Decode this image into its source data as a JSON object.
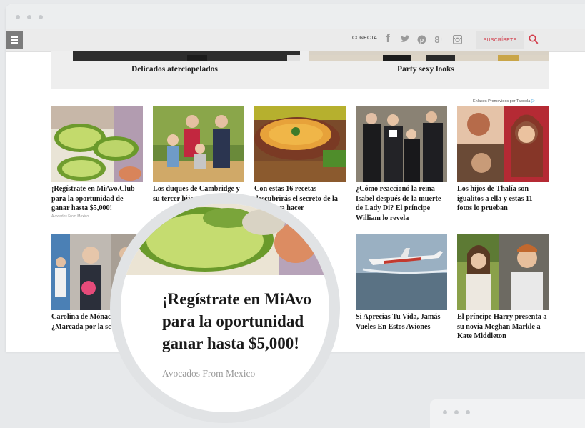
{
  "header": {
    "conecta_label": "CONECTA",
    "social_icons": [
      "facebook-icon",
      "twitter-icon",
      "pinterest-icon",
      "google-plus-icon",
      "instagram-icon"
    ],
    "subscribe_label": "SUSCRÍBETE",
    "accent_color": "#d23c4a"
  },
  "banner": {
    "left_caption": "Delicados aterciopelados",
    "right_caption": "Party sexy looks"
  },
  "sponsor_label": "Enlaces Promovidos por Taboola",
  "cards_row1": [
    {
      "caption": "¡Regístrate en MiAvo.Club para la oportunidad de ganar hasta $5,000!",
      "source": "Avocados From Mexico"
    },
    {
      "caption": "Los duques de Cambridge y su tercer hijo..."
    },
    {
      "caption": "Con estas 16 recetas descubrirás el secreto de la sopa para hacer"
    },
    {
      "caption": "¿Cómo reaccionó la reina Isabel después de la muerte de Lady Di? El príncipe William lo revela"
    },
    {
      "caption": "Los hijos de Thalía son igualitos a ella y estas 11 fotos lo prueban"
    }
  ],
  "cards_row2": [
    {
      "caption": "Carolina de Mónaco ¿Marcada por la sc"
    },
    {
      "caption": "Si Aprecias Tu Vida, Jamás Vueles En Estos Aviones"
    },
    {
      "caption": "El príncipe Harry presenta a su novia Meghan Markle a Kate Middleton"
    }
  ],
  "zoom": {
    "line1": "¡Regístrate en MiAvo",
    "line2": "para la oportunidad",
    "line3": "ganar hasta $5,000!",
    "source": "Avocados From Mexico"
  }
}
